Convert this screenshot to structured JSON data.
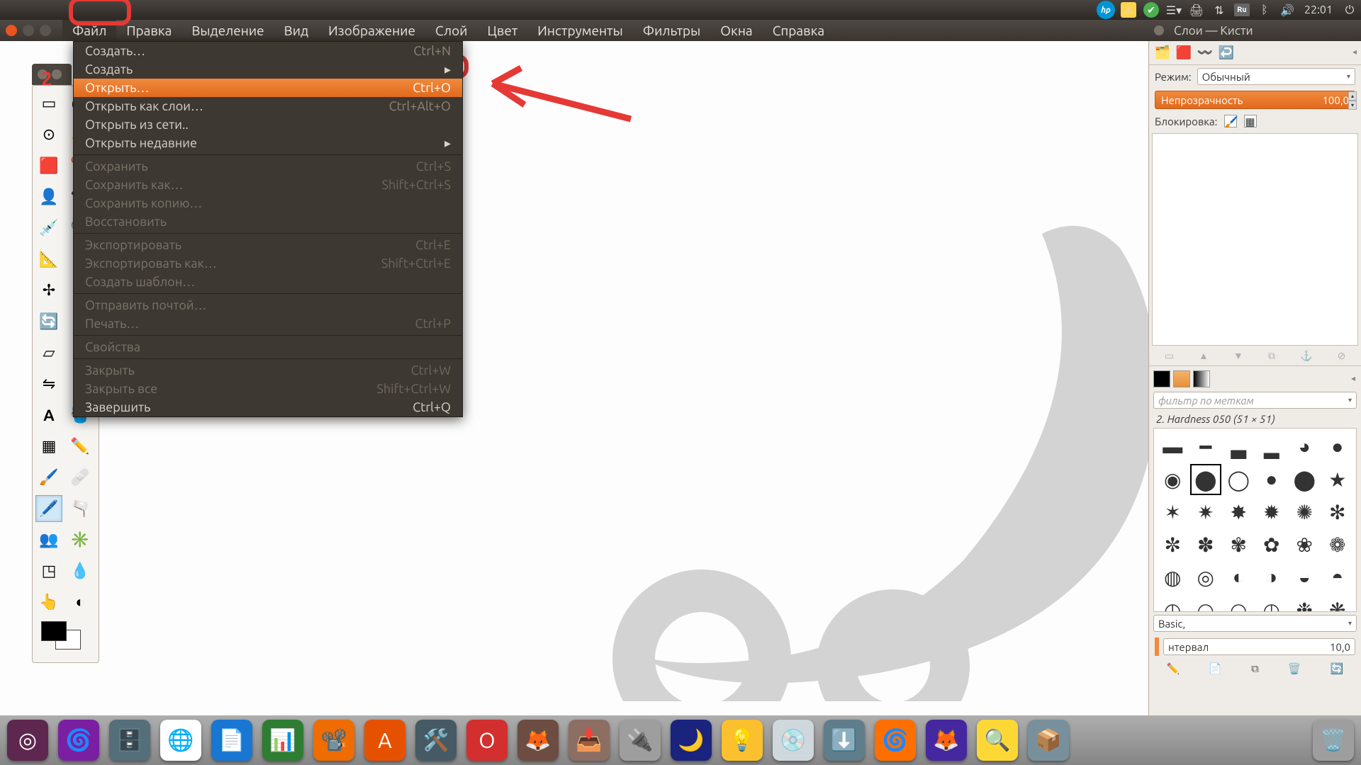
{
  "sysbar": {
    "time": "22:01",
    "lang": "Ru",
    "hp": "hp"
  },
  "menubar": {
    "items": [
      "Файл",
      "Правка",
      "Выделение",
      "Вид",
      "Изображение",
      "Слой",
      "Цвет",
      "Инструменты",
      "Фильтры",
      "Окна",
      "Справка"
    ]
  },
  "dropdown": {
    "create": {
      "label": "Создать…",
      "sc": "Ctrl+N"
    },
    "create_sub": {
      "label": "Создать"
    },
    "open": {
      "label": "Открыть…",
      "sc": "Ctrl+O"
    },
    "open_as_layer": {
      "label": "Открыть как слои…",
      "sc": "Ctrl+Alt+O"
    },
    "open_net": {
      "label": "Открыть из сети.."
    },
    "open_recent": {
      "label": "Открыть недавние"
    },
    "save": {
      "label": "Сохранить",
      "sc": "Ctrl+S"
    },
    "save_as": {
      "label": "Сохранить как…",
      "sc": "Shift+Ctrl+S"
    },
    "save_copy": {
      "label": "Сохранить копию…"
    },
    "revert": {
      "label": "Восстановить"
    },
    "export": {
      "label": "Экспортировать",
      "sc": "Ctrl+E"
    },
    "export_as": {
      "label": "Экспортировать как…",
      "sc": "Shift+Ctrl+E"
    },
    "template": {
      "label": "Создать шаблон…"
    },
    "mail": {
      "label": "Отправить почтой…"
    },
    "print": {
      "label": "Печать…",
      "sc": "Ctrl+P"
    },
    "props": {
      "label": "Свойства"
    },
    "close": {
      "label": "Закрыть",
      "sc": "Ctrl+W"
    },
    "close_all": {
      "label": "Закрыть все",
      "sc": "Shift+Ctrl+W"
    },
    "quit": {
      "label": "Завершить",
      "sc": "Ctrl+Q"
    }
  },
  "annotation": {
    "number": "2"
  },
  "rpanel": {
    "title": "Слои — Кисти",
    "mode_label": "Режим:",
    "mode_value": "Обычный",
    "opacity_label": "Непрозрачность",
    "opacity_value": "100,0",
    "lock_label": "Блокировка:",
    "brush_filter_placeholder": "фильтр по меткам",
    "brush_info": "2. Hardness 050 (51 × 51)",
    "brush_select_value": "Basic,",
    "interval_label": "нтервал",
    "interval_value": "10,0"
  }
}
